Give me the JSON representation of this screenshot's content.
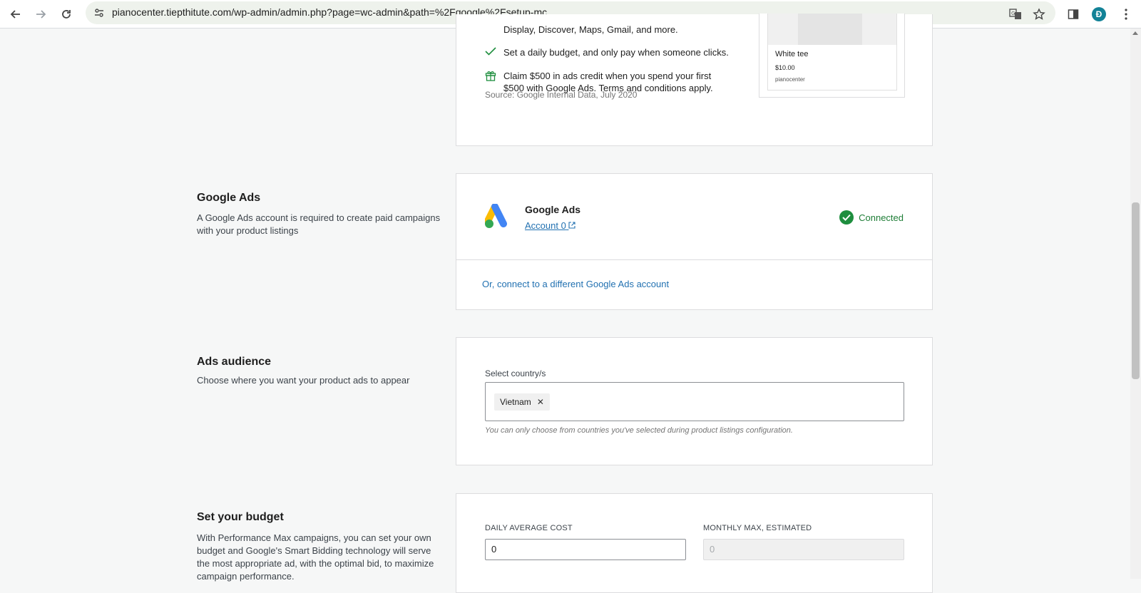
{
  "browser": {
    "url": "pianocenter.tiepthitute.com/wp-admin/admin.php?page=wc-admin&path=%2Fgoogle%2Fsetup-mc",
    "avatar_initial": "Đ"
  },
  "intro_card": {
    "bullet_1_partial": "Display, Discover, Maps, Gmail, and more.",
    "bullet_2": "Set a daily budget, and only pay when someone clicks.",
    "bullet_3_line1": "Claim $500 in ads credit when you spend your first",
    "bullet_3_line2": "$500 with Google Ads. Terms and conditions apply.",
    "source": "Source: Google Internal Data, July 2020",
    "product": {
      "name": "White tee",
      "price": "$10.00",
      "store": "pianocenter"
    }
  },
  "google_ads": {
    "title": "Google Ads",
    "description": "A Google Ads account is required to create paid campaigns with your product listings",
    "card_title": "Google Ads",
    "account_link": "Account 0",
    "status": "Connected",
    "alt_link": "Or, connect to a different Google Ads account"
  },
  "audience": {
    "title": "Ads audience",
    "description": "Choose where you want your product ads to appear",
    "field_label": "Select country/s",
    "selected": [
      "Vietnam"
    ],
    "remove_symbol": "✕",
    "help": "You can only choose from countries you've selected during product listings configuration."
  },
  "budget": {
    "title": "Set your budget",
    "description": "With Performance Max campaigns, you can set your own budget and Google's Smart Bidding technology will serve the most appropriate ad, with the optimal bid, to maximize campaign performance.",
    "daily_label": "DAILY AVERAGE COST",
    "daily_value": "0",
    "monthly_label": "MONTHLY MAX, ESTIMATED",
    "monthly_placeholder": "0"
  },
  "colors": {
    "link": "#2271b1",
    "connected": "#1e8e3e",
    "background": "#f6f7f7"
  }
}
